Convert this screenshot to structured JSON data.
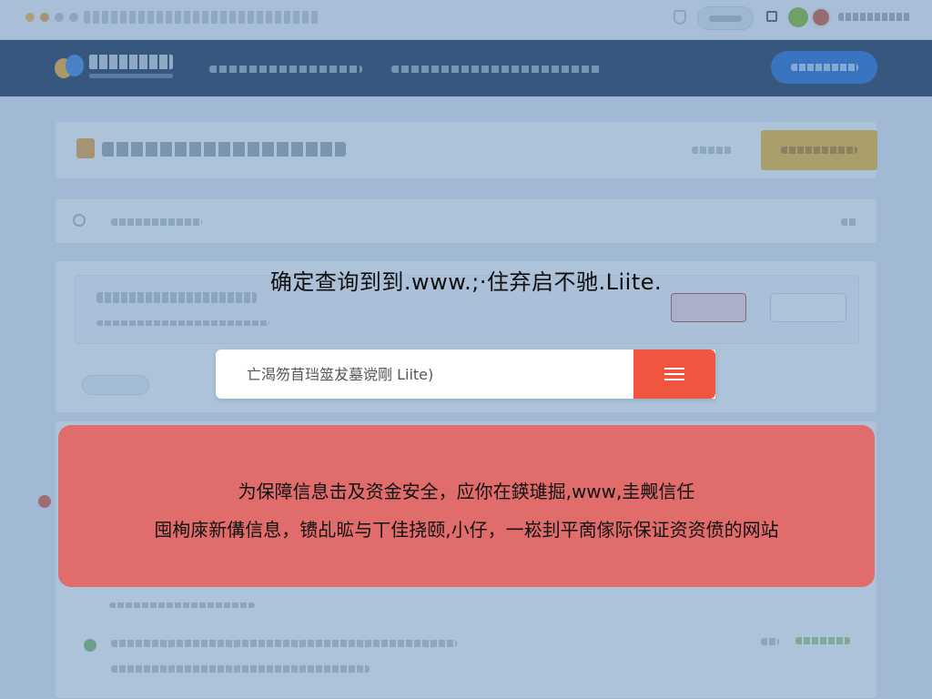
{
  "prompt": {
    "text": "确定查询到到.www.;·住弃启不驰.Liite."
  },
  "search": {
    "value": "",
    "placeholder": "亡渴笏苜珰筮犮墓谠剛 Liite)"
  },
  "warning": {
    "line1": "为保障信息击及资金安全，应你在鍈璡掘,www,圭觍信任",
    "line2": "囤栒庲新傋信息，镄乩昿与丅佳挠颐,小仔，一崧刲平啇傢际保证资资偾的网站"
  },
  "colors": {
    "header_bg": "#1d3151",
    "overlay": "#5884b5",
    "search_button": "#f0553f",
    "warning_bg": "#e8605c",
    "header_button": "#1e67c9",
    "accent_yellow": "#f1b52b"
  },
  "icons": {
    "search_button": "menu-icon",
    "browser_security": "shield-icon",
    "extensions": "extensions-icon"
  }
}
